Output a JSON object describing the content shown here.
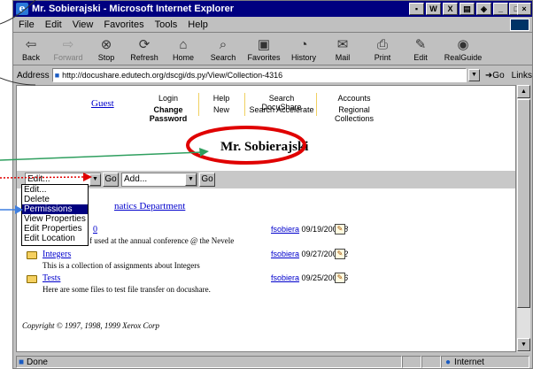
{
  "window": {
    "title": "Mr. Sobierajski - Microsoft Internet Explorer"
  },
  "menubar": {
    "items": [
      "File",
      "Edit",
      "View",
      "Favorites",
      "Tools",
      "Help"
    ]
  },
  "toolbar": {
    "back": "Back",
    "forward": "Forward",
    "stop": "Stop",
    "refresh": "Refresh",
    "home": "Home",
    "search": "Search",
    "favorites": "Favorites",
    "history": "History",
    "mail": "Mail",
    "print": "Print",
    "edit": "Edit",
    "realguide": "RealGuide"
  },
  "address": {
    "label": "Address",
    "url": "http://docushare.edutech.org/dscgi/ds.py/View/Collection-4316",
    "go": "Go",
    "links": "Links"
  },
  "page": {
    "guest": "Guest",
    "nav": {
      "login": "Login",
      "change_password": "Change Password",
      "help": "Help",
      "new": "New",
      "search_docushare": "Search DocuShare",
      "search_accelerate": "Search Accelerate",
      "accounts": "Accounts",
      "regional_collections": "Regional Collections"
    },
    "heading": "Mr. Sobierajski",
    "action_select": "Edit...",
    "go1": "Go",
    "add_select": "Add...",
    "go2": "Go",
    "menu_options": [
      "Edit...",
      "Delete",
      "Permissions",
      "View Properties",
      "Edit Properties",
      "Edit Location"
    ],
    "selected_option": "Permissions",
    "parent_link": "natics Department",
    "items": [
      {
        "title": "0",
        "desc": "f used at the annual conference @ the Nevele",
        "owner": "fsobiera",
        "date": "09/19/2000",
        "count": "8"
      },
      {
        "title": "Integers",
        "desc": "This is a collection of assignments about Integers",
        "owner": "fsobiera",
        "date": "09/27/2000",
        "count": "2"
      },
      {
        "title": "Tests",
        "desc": "Here are some files to test file transfer on docushare.",
        "owner": "fsobiera",
        "date": "09/25/2000",
        "count": "6"
      }
    ],
    "copyright": "Copyright © 1997, 1998, 1999 Xerox Corp"
  },
  "status": {
    "left": "Done",
    "zone": "Internet"
  },
  "colors": {
    "titlebar": "#000080",
    "link": "#0000cc",
    "annotation_red": "#e00000",
    "annotation_green": "#2f9f5f",
    "annotation_blue": "#3f7fe0"
  }
}
